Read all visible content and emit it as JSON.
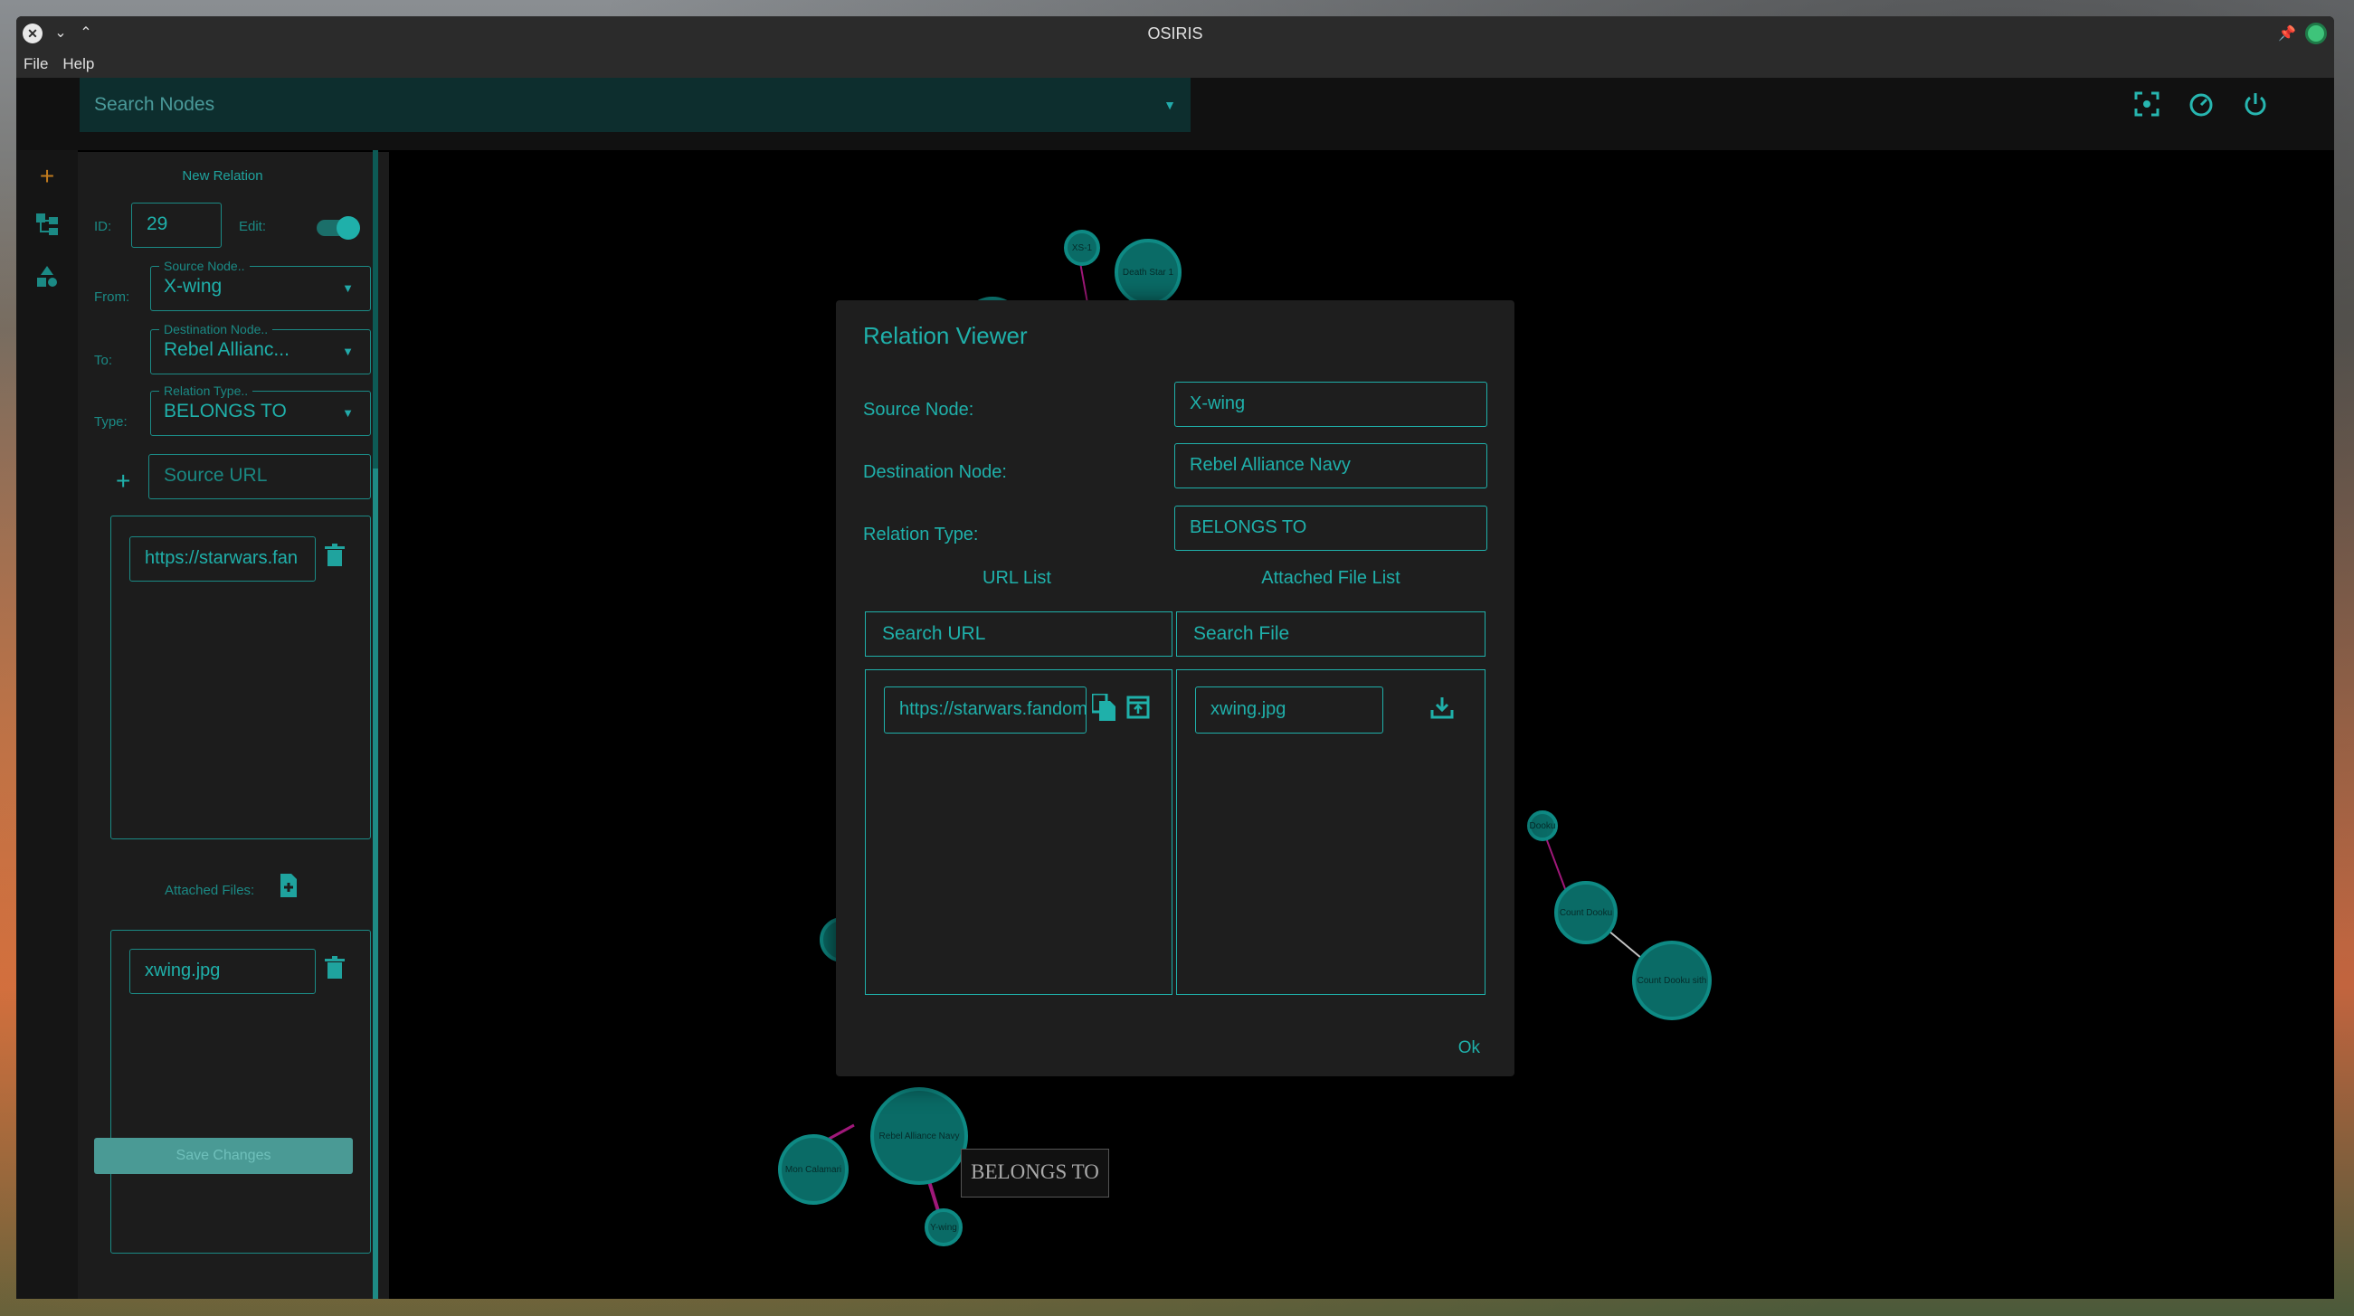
{
  "window": {
    "title": "OSIRIS"
  },
  "menu": {
    "file": "File",
    "help": "Help"
  },
  "topbar": {
    "search_placeholder": "Search Nodes"
  },
  "sidepanel": {
    "title": "New Relation",
    "id_label": "ID:",
    "id_value": "29",
    "edit_label": "Edit:",
    "edit_on": true,
    "from_label": "From:",
    "source_float": "Source Node..",
    "source_value": "X-wing",
    "to_label": "To:",
    "dest_float": "Destination Node..",
    "dest_value": "Rebel Allianc...",
    "type_label": "Type:",
    "type_float": "Relation Type..",
    "type_value": "BELONGS TO",
    "source_url_placeholder": "Source URL",
    "url_item": "https://starwars.fan",
    "attached_label": "Attached Files:",
    "file_item": "xwing.jpg",
    "save_label": "Save Changes"
  },
  "graph": {
    "nodes": [
      "XS-1",
      "Death Star 1",
      "Rebel Alliance Navy",
      "Mon Calamari",
      "Y-wing",
      "Dooku",
      "Count Dooku",
      "Count Dooku sith"
    ],
    "edge_tooltip": "BELONGS TO"
  },
  "dialog": {
    "title": "Relation Viewer",
    "source_label": "Source Node:",
    "source_value": "X-wing",
    "dest_label": "Destination Node:",
    "dest_value": "Rebel Alliance Navy",
    "type_label": "Relation Type:",
    "type_value": "BELONGS TO",
    "url_list_header": "URL List",
    "file_list_header": "Attached File List",
    "search_url": "Search URL",
    "search_file": "Search File",
    "url_item": "https://starwars.fandom.com",
    "file_item": "xwing.jpg",
    "ok_label": "Ok"
  },
  "colors": {
    "accent": "#1fb0aa",
    "node_fill": "#0a6b66",
    "edge_highlight": "#a0187a"
  }
}
